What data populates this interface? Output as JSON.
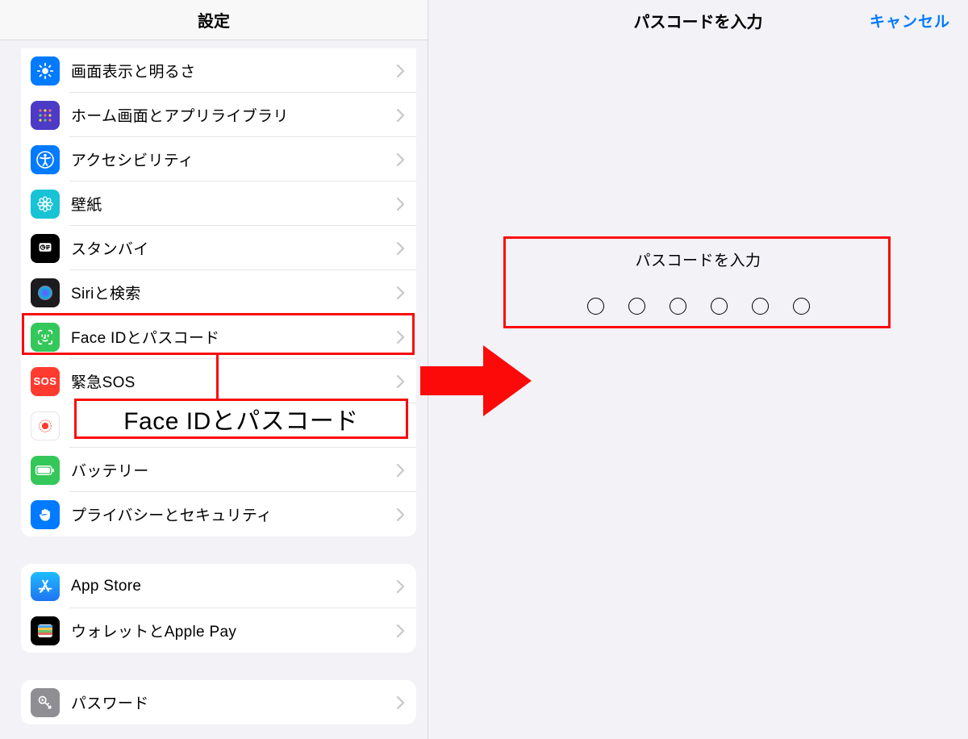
{
  "left": {
    "title": "設定",
    "group1": [
      {
        "id": "display",
        "label": "画面表示と明るさ",
        "icon": "brightness",
        "bg": "#007aff"
      },
      {
        "id": "home",
        "label": "ホーム画面とアプリライブラリ",
        "icon": "appgrid",
        "bg": "#4b3bc6"
      },
      {
        "id": "accessibility",
        "label": "アクセシビリティ",
        "icon": "accessibility",
        "bg": "#007aff"
      },
      {
        "id": "wallpaper",
        "label": "壁紙",
        "icon": "flower",
        "bg": "#18c3d6"
      },
      {
        "id": "standby",
        "label": "スタンバイ",
        "icon": "standby",
        "bg": "#000000"
      },
      {
        "id": "siri",
        "label": "Siriと検索",
        "icon": "siri",
        "bg": "#1c1c1e"
      },
      {
        "id": "faceid",
        "label": "Face IDとパスコード",
        "icon": "faceid",
        "bg": "#34c759"
      },
      {
        "id": "sos",
        "label": "緊急SOS",
        "icon": "sos",
        "bg": "#ff3b30"
      },
      {
        "id": "screentime",
        "label": " ",
        "icon": "screentime",
        "bg": "#ffffff"
      },
      {
        "id": "battery",
        "label": "バッテリー",
        "icon": "battery",
        "bg": "#34c759"
      },
      {
        "id": "privacy",
        "label": "プライバシーとセキュリティ",
        "icon": "hand",
        "bg": "#007aff"
      }
    ],
    "group2": [
      {
        "id": "appstore",
        "label": "App Store",
        "icon": "appstore",
        "bg": "#1e9af1"
      },
      {
        "id": "wallet",
        "label": "ウォレットとApple Pay",
        "icon": "wallet",
        "bg": "#000000"
      }
    ],
    "group3": [
      {
        "id": "passwords",
        "label": "パスワード",
        "icon": "key",
        "bg": "#8e8e93"
      }
    ]
  },
  "callout_text": "Face IDとパスコード",
  "right": {
    "title": "パスコードを入力",
    "cancel": "キャンセル",
    "prompt": "パスコードを入力",
    "digits": 6
  },
  "colors": {
    "accent_red": "#fc0a0a",
    "ios_blue": "#007aff"
  }
}
